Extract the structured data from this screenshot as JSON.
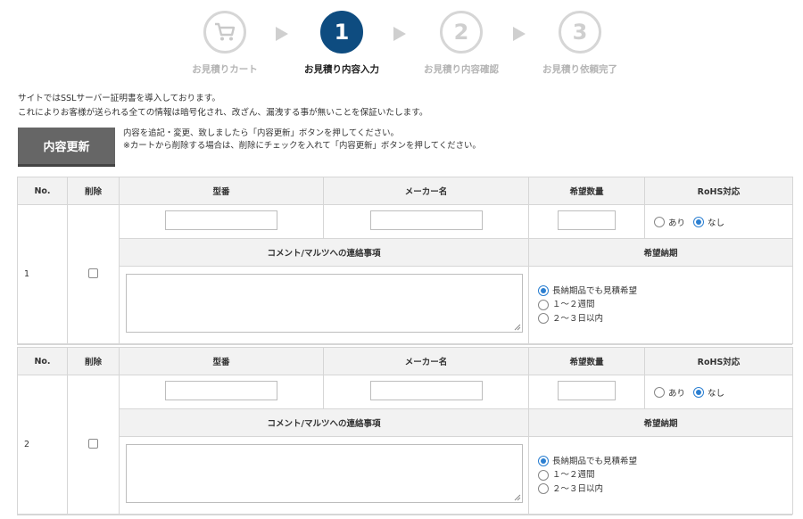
{
  "steps": [
    {
      "label": "お見積りカート",
      "number": "",
      "icon": "cart-icon",
      "state": "done"
    },
    {
      "label": "お見積り内容入力",
      "number": "1",
      "state": "active"
    },
    {
      "label": "お見積り内容確認",
      "number": "2",
      "state": "pending"
    },
    {
      "label": "お見積り依頼完了",
      "number": "3",
      "state": "pending"
    }
  ],
  "notice": {
    "line1": "サイトではSSLサーバー証明書を導入しております。",
    "line2": "これによりお客様が送られる全ての情報は暗号化され、改ざん、漏洩する事が無いことを保証いたします。"
  },
  "update": {
    "button_label": "内容更新",
    "help_line1": "内容を追記・変更、致しましたら「内容更新」ボタンを押してください。",
    "help_line2": "※カートから削除する場合は、削除にチェックを入れて「内容更新」ボタンを押してください。"
  },
  "headers": {
    "no": "No.",
    "delete": "削除",
    "model": "型番",
    "maker": "メーカー名",
    "quantity": "希望数量",
    "rohs": "RoHS対応",
    "comment": "コメント/マルツへの連絡事項",
    "delivery": "希望納期"
  },
  "rohs_options": [
    "あり",
    "なし"
  ],
  "delivery_options": [
    "長納期品でも見積希望",
    "１～２週間",
    "２～３日以内"
  ],
  "items": [
    {
      "no": "1",
      "delete_checked": false,
      "model": "",
      "maker": "",
      "quantity": "",
      "rohs": "なし",
      "comment": "",
      "delivery": "長納期品でも見積希望"
    },
    {
      "no": "2",
      "delete_checked": false,
      "model": "",
      "maker": "",
      "quantity": "",
      "rohs": "なし",
      "comment": "",
      "delivery": "長納期品でも見積希望"
    }
  ],
  "colors": {
    "active_step": "#0e4c80",
    "radio_selected": "#2b7fd1",
    "button_bg": "#666666"
  }
}
